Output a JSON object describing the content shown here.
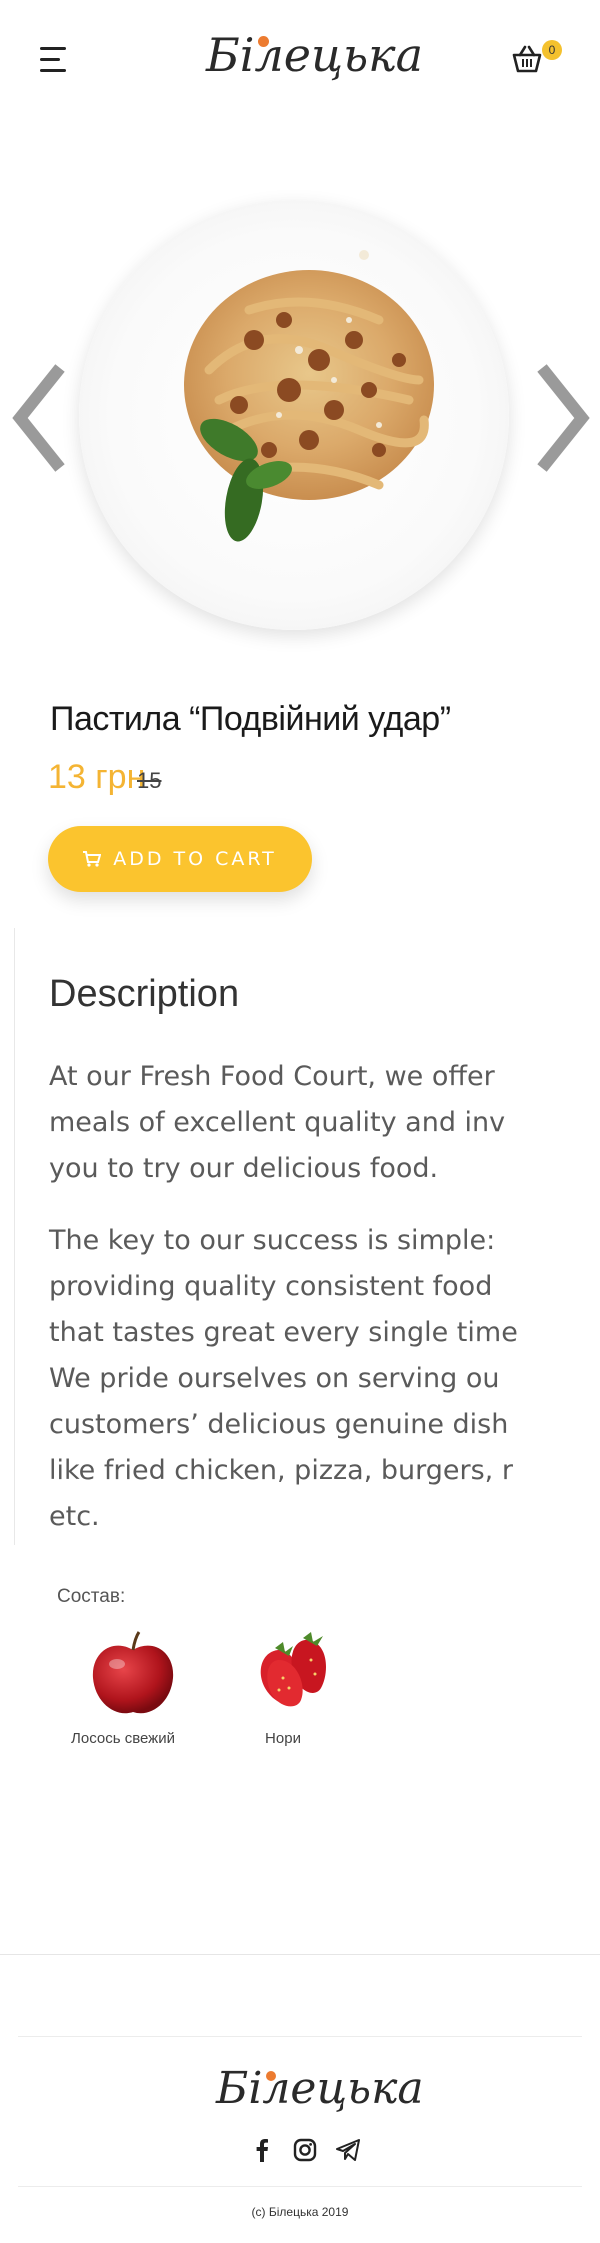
{
  "header": {
    "logo_text": "Білецька",
    "cart_count": "0",
    "icons": [
      "menu-icon",
      "basket-icon"
    ]
  },
  "slider": {
    "image": "pasta-plate",
    "prev_icon": "chevron-left-icon",
    "next_icon": "chevron-right-icon"
  },
  "product": {
    "title": "Пастила “Подвійний удар”",
    "price": "13 грн",
    "old_price": "15",
    "add_to_cart_label": "ADD TO CART"
  },
  "description": {
    "heading": "Description",
    "paragraph1": [
      "At our Fresh Food Court, we offer",
      "meals of excellent quality and inv",
      "you to try our delicious food."
    ],
    "paragraph2": [
      "The key to our success is simple:",
      "providing quality consistent food",
      "that tastes great every single time",
      "We pride ourselves on serving ou",
      "customers’ delicious genuine dish",
      "like fried chicken, pizza, burgers, r",
      "etc."
    ]
  },
  "composition": {
    "label": "Состав:",
    "items": [
      {
        "name": "Лосось свежий",
        "image": "apple"
      },
      {
        "name": "Нори",
        "image": "strawberries"
      }
    ]
  },
  "footer": {
    "logo_text": "Білецька",
    "social": [
      "facebook-icon",
      "instagram-icon",
      "telegram-icon"
    ],
    "copyright": "(c) Білецька 2019"
  },
  "colors": {
    "accent": "#fbc42e",
    "price": "#f4b433",
    "logo_dot": "#ec7b30"
  }
}
